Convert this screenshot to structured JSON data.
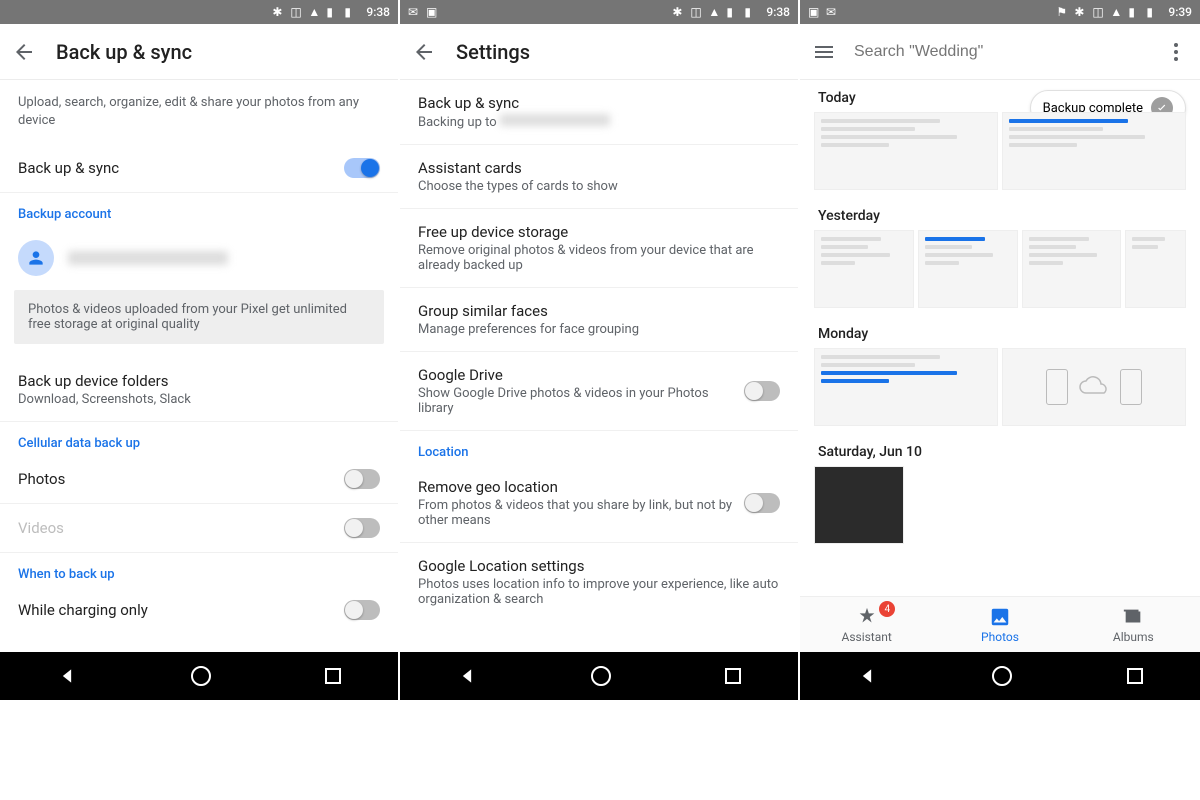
{
  "status": {
    "time1": "9:38",
    "time2": "9:38",
    "time3": "9:39"
  },
  "p1": {
    "title": "Back up & sync",
    "intro": "Upload, search, organize, edit & share your photos from any device",
    "toggle_label": "Back up & sync",
    "section_account": "Backup account",
    "notice": "Photos & videos uploaded from your Pixel get unlimited free storage at original quality",
    "folders_title": "Back up device folders",
    "folders_sub": "Download, Screenshots, Slack",
    "section_cell": "Cellular data back up",
    "cell_photos": "Photos",
    "cell_videos": "Videos",
    "section_when": "When to back up",
    "when_charging": "While charging only"
  },
  "p2": {
    "title": "Settings",
    "items": [
      {
        "pri": "Back up & sync",
        "sec": "Backing up to"
      },
      {
        "pri": "Assistant cards",
        "sec": "Choose the types of cards to show"
      },
      {
        "pri": "Free up device storage",
        "sec": "Remove original photos & videos from your device that are already backed up"
      },
      {
        "pri": "Group similar faces",
        "sec": "Manage preferences for face grouping"
      },
      {
        "pri": "Google Drive",
        "sec": "Show Google Drive photos & videos in your Photos library",
        "toggle": true
      }
    ],
    "section_location": "Location",
    "loc_items": [
      {
        "pri": "Remove geo location",
        "sec": "From photos & videos that you share by link, but not by other means",
        "toggle": true
      },
      {
        "pri": "Google Location settings",
        "sec": "Photos uses location info to improve your experience, like auto organization & search"
      }
    ]
  },
  "p3": {
    "search_placeholder": "Search \"Wedding\"",
    "chip": "Backup complete",
    "dates": {
      "d1": "Today",
      "d2": "Yesterday",
      "d3": "Monday",
      "d4": "Saturday, Jun 10"
    },
    "nav": {
      "assistant": "Assistant",
      "photos": "Photos",
      "albums": "Albums",
      "badge": "4"
    }
  }
}
